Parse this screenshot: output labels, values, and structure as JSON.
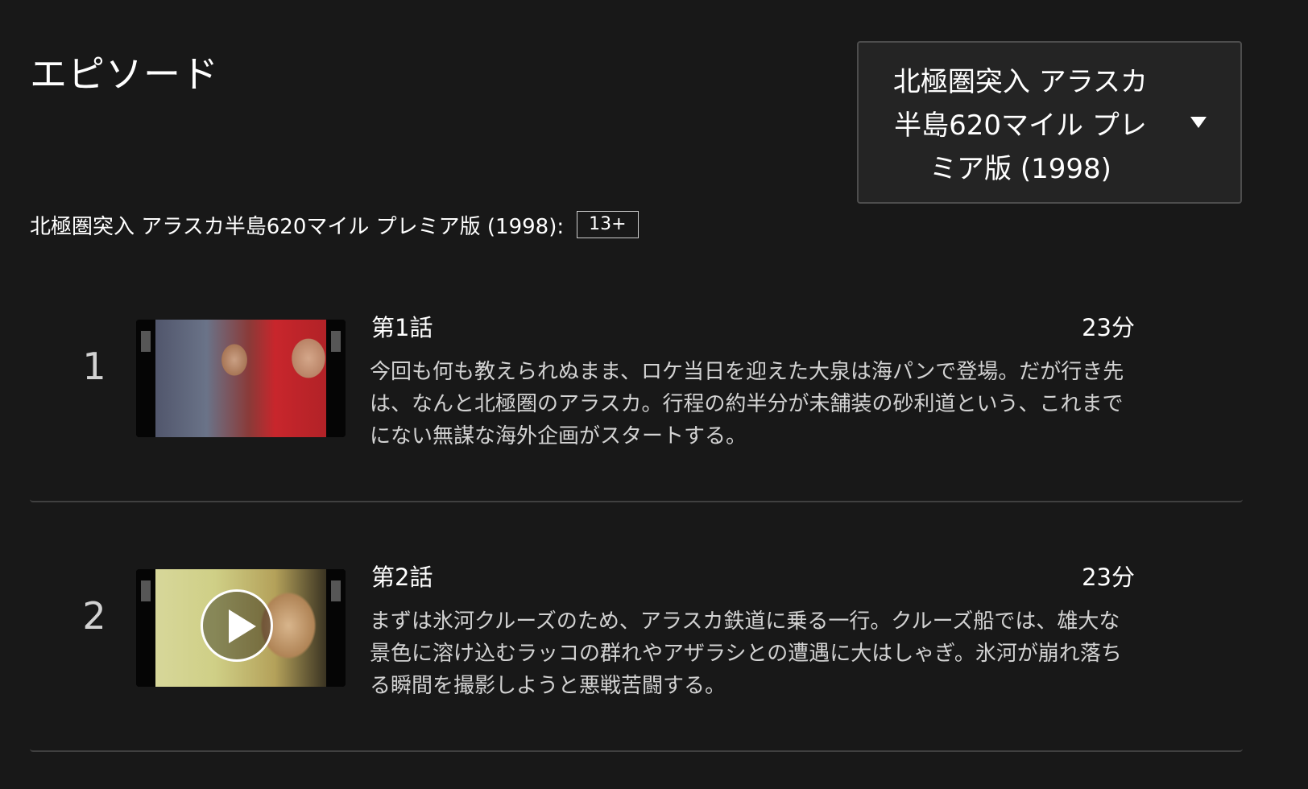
{
  "heading": "エピソード",
  "season_selector": {
    "label": "北極圏突入 アラスカ半島620マイル プレミア版 (1998)",
    "icon": "caret-down-icon"
  },
  "show_info": {
    "title": "北極圏突入 アラスカ半島620マイル プレミア版 (1998):",
    "rating": "13+"
  },
  "episodes": [
    {
      "number": "1",
      "title": "第1話",
      "duration": "23分",
      "description": "今回も何も教えられぬまま、ロケ当日を迎えた大泉は海パンで登場。だが行き先は、なんと北極圏のアラスカ。行程の約半分が未舗装の砂利道という、これまでにない無謀な海外企画がスタートする。",
      "thumbnail_play_icon": false
    },
    {
      "number": "2",
      "title": "第2話",
      "duration": "23分",
      "description": "まずは氷河クルーズのため、アラスカ鉄道に乗る一行。クルーズ船では、雄大な景色に溶け込むラッコの群れやアザラシとの遭遇に大はしゃぎ。氷河が崩れ落ちる瞬間を撮影しようと悪戦苦闘する。",
      "thumbnail_play_icon": true
    }
  ]
}
